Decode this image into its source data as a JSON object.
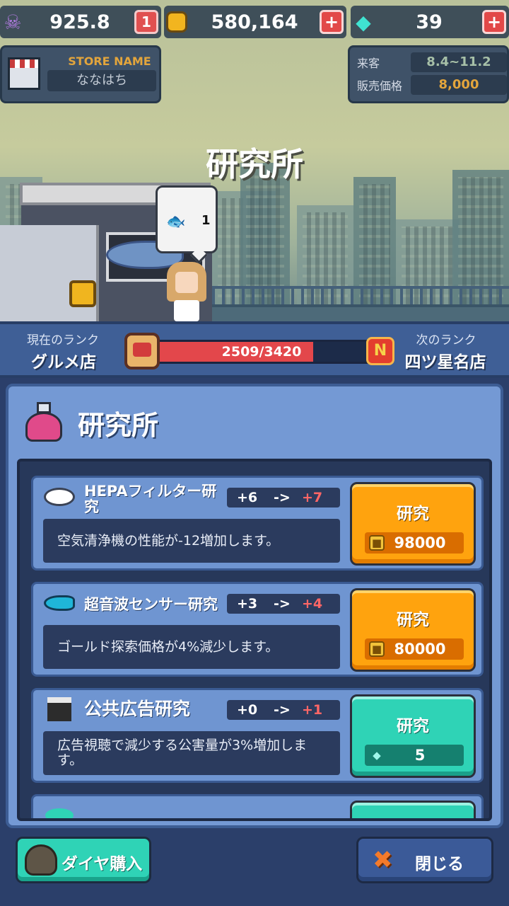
{
  "topbar": {
    "pollution": {
      "icon": "skull-icon",
      "value": "925.8",
      "badge": "1"
    },
    "gold": {
      "icon": "gold-coin-icon",
      "value": "580,164",
      "plus": "+"
    },
    "diamond": {
      "icon": "diamond-icon",
      "value": "39",
      "plus": "+"
    }
  },
  "store": {
    "label": "STORE NAME",
    "name": "ななはち"
  },
  "stats": {
    "visitors_label": "来客",
    "visitors_value": "8.4~11.2",
    "price_label": "販売価格",
    "price_value": "8,000"
  },
  "scene": {
    "title": "研究所",
    "bubble_count": "1",
    "bubble_icon": "fish-icon"
  },
  "rank": {
    "current_label": "現在のランク",
    "current_value": "グルメ店",
    "progress_text": "2509/3420",
    "progress_fraction": 0.7337,
    "next_badge": "N",
    "next_label": "次のランク",
    "next_value": "四ツ星名店"
  },
  "panel": {
    "title": "研究所",
    "icon": "flask-icon"
  },
  "research": [
    {
      "icon": "air-purifier-icon",
      "name": "HEPAフィルター研究",
      "from": "+6",
      "arrow": "->",
      "to": "+7",
      "desc": "空気清浄機の性能が-12増加します。",
      "button": "研究",
      "cost_icon": "gold-coin-icon",
      "cost": "98000",
      "color": "orange"
    },
    {
      "icon": "sonar-fish-icon",
      "name": "超音波センサー研究",
      "from": "+3",
      "arrow": "->",
      "to": "+4",
      "desc": "ゴールド探索価格が4%減少します。",
      "button": "研究",
      "cost_icon": "gold-coin-icon",
      "cost": "80000",
      "color": "orange"
    },
    {
      "icon": "clapperboard-icon",
      "name": "公共広告研究",
      "from": "+0",
      "arrow": "->",
      "to": "+1",
      "desc": "広告視聴で減少する公害量が3%増加します。",
      "button": "研究",
      "cost_icon": "diamond-icon",
      "cost": "5",
      "color": "teal"
    }
  ],
  "footer": {
    "buy_diamond": "ダイヤ購入",
    "close": "閉じる",
    "close_icon": "close-icon"
  },
  "colors": {
    "accent_orange": "#ffa30e",
    "accent_teal": "#2fd3b6",
    "panel_blue": "#7499d4",
    "progress_red": "#e3474b"
  }
}
